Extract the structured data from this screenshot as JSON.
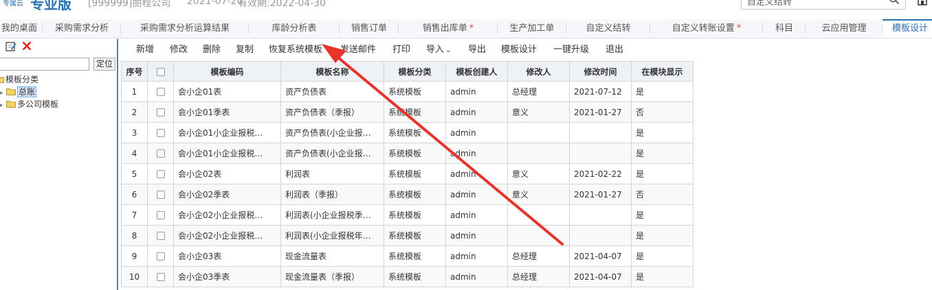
{
  "header": {
    "brand_small": "专属云",
    "brand_big": "专业版",
    "company": "[999999]丽程公司",
    "date": "2021-07-20",
    "validity": "有效期:2022-04-30",
    "search_value": "自定义结转",
    "search_icon": "search-icon",
    "home_icon": "home-icon"
  },
  "tabs": [
    {
      "label": "我的桌面",
      "unsaved": false,
      "active": false
    },
    {
      "label": "采购需求分析",
      "unsaved": false,
      "active": false
    },
    {
      "label": "采购需求分析运算结果",
      "unsaved": false,
      "active": false
    },
    {
      "label": "库龄分析表",
      "unsaved": false,
      "active": false
    },
    {
      "label": "销售订单",
      "unsaved": false,
      "active": false
    },
    {
      "label": "销售出库单",
      "unsaved": true,
      "active": false
    },
    {
      "label": "生产加工单",
      "unsaved": false,
      "active": false
    },
    {
      "label": "自定义结转",
      "unsaved": false,
      "active": false
    },
    {
      "label": "自定义转账设置",
      "unsaved": true,
      "active": false
    },
    {
      "label": "科目",
      "unsaved": false,
      "active": false
    },
    {
      "label": "云应用管理",
      "unsaved": false,
      "active": false
    },
    {
      "label": "模板设计",
      "unsaved": false,
      "active": true
    }
  ],
  "tab_unsaved_mark": "*",
  "left": {
    "edit_icon": "edit-icon",
    "delete_icon": "delete-icon",
    "locate_value": "",
    "locate_button": "定位",
    "tree_root": "模板分类",
    "tree_items": [
      {
        "label": "总账",
        "selected": true
      },
      {
        "label": "多公司模板",
        "selected": false
      }
    ]
  },
  "toolbar": {
    "new": "新增",
    "modify": "修改",
    "delete": "删除",
    "copy": "复制",
    "restore": "恢复系统模板",
    "send_mail": "发送邮件",
    "print": "打印",
    "import": "导入",
    "export": "导出",
    "design": "模板设计",
    "upgrade": "一键升级",
    "exit": "退出"
  },
  "grid": {
    "headers": {
      "idx": "序号",
      "code": "模板编码",
      "name": "模板名称",
      "category": "模板分类",
      "creator": "模板创建人",
      "modifier": "修改人",
      "mtime": "修改时间",
      "show": "在模块显示"
    },
    "rows": [
      {
        "idx": "1",
        "code": "会小企01表",
        "name": "资产负债表",
        "category": "系统模板",
        "creator": "admin",
        "modifier": "总经理",
        "mtime": "2021-07-12",
        "show": "是"
      },
      {
        "idx": "2",
        "code": "会小企01季表",
        "name": "资产负债表（季报）",
        "category": "系统模板",
        "creator": "admin",
        "modifier": "意义",
        "mtime": "2021-01-27",
        "show": "否"
      },
      {
        "idx": "3",
        "code": "会小企01小企业报税…",
        "name": "资产负债表(小企业报…",
        "category": "系统模板",
        "creator": "admin",
        "modifier": "",
        "mtime": "",
        "show": "是"
      },
      {
        "idx": "4",
        "code": "会小企01小企业报税…",
        "name": "资产负债表(小企业报…",
        "category": "系统模板",
        "creator": "admin",
        "modifier": "",
        "mtime": "",
        "show": "是"
      },
      {
        "idx": "5",
        "code": "会小企02表",
        "name": "利润表",
        "category": "系统模板",
        "creator": "admin",
        "modifier": "意义",
        "mtime": "2021-02-22",
        "show": "是"
      },
      {
        "idx": "6",
        "code": "会小企02季表",
        "name": "利润表（季报）",
        "category": "系统模板",
        "creator": "admin",
        "modifier": "意义",
        "mtime": "2021-01-27",
        "show": "否"
      },
      {
        "idx": "7",
        "code": "会小企02小企业报税…",
        "name": "利润表(小企业报税季…",
        "category": "系统模板",
        "creator": "admin",
        "modifier": "",
        "mtime": "",
        "show": "是"
      },
      {
        "idx": "8",
        "code": "会小企02小企业报税…",
        "name": "利润表(小企业报税年…",
        "category": "系统模板",
        "creator": "admin",
        "modifier": "",
        "mtime": "",
        "show": "是"
      },
      {
        "idx": "9",
        "code": "会小企03表",
        "name": "现金流量表",
        "category": "系统模板",
        "creator": "admin",
        "modifier": "总经理",
        "mtime": "2021-04-07",
        "show": "是"
      },
      {
        "idx": "10",
        "code": "会小企03季表",
        "name": "现金流量表（季报）",
        "category": "系统模板",
        "creator": "admin",
        "modifier": "总经理",
        "mtime": "2021-04-07",
        "show": "是"
      }
    ]
  },
  "colors": {
    "accent": "#2a6fb0",
    "tab_bar_bg": "#f5f7fa",
    "panel_border": "#4a7cc0",
    "annotation_arrow": "#e8332a",
    "header_bg": "#eef1f5"
  }
}
